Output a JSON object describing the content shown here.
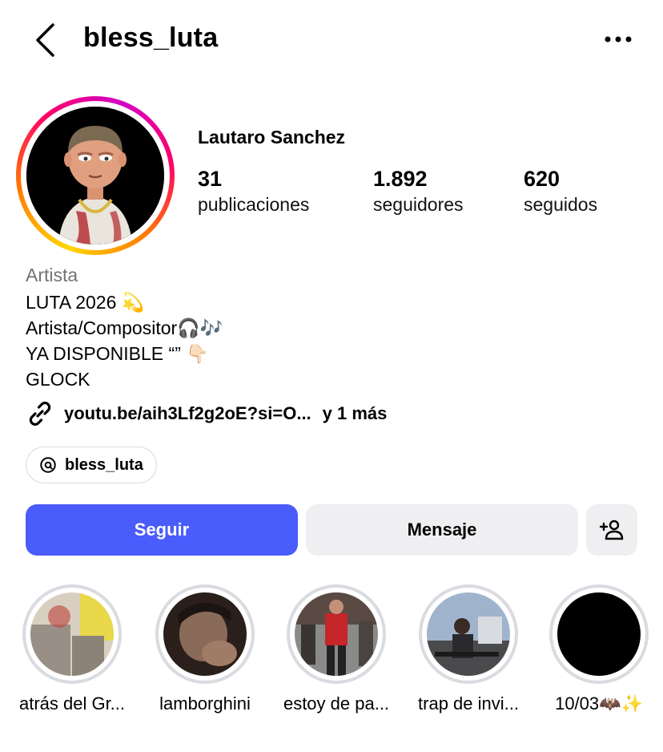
{
  "header": {
    "username": "bless_luta"
  },
  "profile": {
    "full_name": "Lautaro Sanchez",
    "stats": [
      {
        "value": "31",
        "label": "publicaciones"
      },
      {
        "value": "1.892",
        "label": "seguidores"
      },
      {
        "value": "620",
        "label": "seguidos"
      }
    ]
  },
  "bio": {
    "category": "Artista",
    "lines": [
      "LUTA 2026 💫",
      "Artista/Compositor🎧🎶",
      "YA DISPONIBLE “” 👇🏻",
      "GLOCK"
    ],
    "link": "youtu.be/aih3Lf2g2oE?si=O...",
    "link_more": "y 1 más",
    "threads_handle": "bless_luta"
  },
  "buttons": {
    "follow": "Seguir",
    "message": "Mensaje"
  },
  "highlights": [
    {
      "label": "atrás del Gr..."
    },
    {
      "label": "lamborghini"
    },
    {
      "label": "estoy de pa..."
    },
    {
      "label": "trap de invi..."
    },
    {
      "label": "10/03🦇✨"
    }
  ],
  "colors": {
    "accent": "#4a5cfb",
    "secondary_button": "#efeff2",
    "muted_text": "#737373",
    "highlight_ring": "#d9dbe0"
  }
}
